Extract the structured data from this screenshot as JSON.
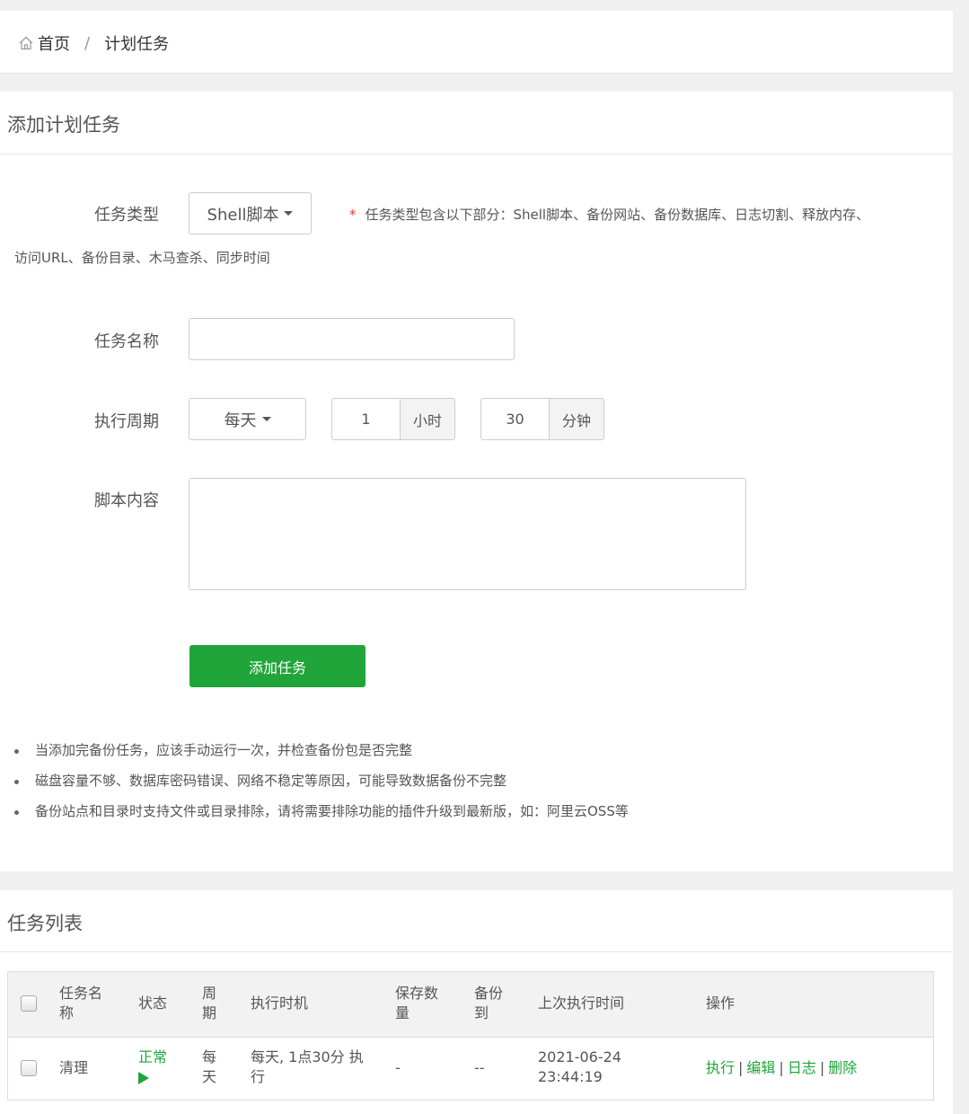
{
  "breadcrumb": {
    "home": "首页",
    "separator": "/",
    "current": "计划任务"
  },
  "form": {
    "title": "添加计划任务",
    "task_type": {
      "label": "任务类型",
      "value": "Shell脚本",
      "hint_star": "*",
      "hint_line1": "任务类型包含以下部分：Shell脚本、备份网站、备份数据库、日志切割、释放内存、",
      "hint_line2": "访问URL、备份目录、木马查杀、同步时间"
    },
    "task_name": {
      "label": "任务名称",
      "value": ""
    },
    "period": {
      "label": "执行周期",
      "value": "每天",
      "hour": "1",
      "hour_unit": "小时",
      "minute": "30",
      "minute_unit": "分钟"
    },
    "script": {
      "label": "脚本内容",
      "value": ""
    },
    "submit_label": "添加任务",
    "tips": [
      "当添加完备份任务，应该手动运行一次，并检查备份包是否完整",
      "磁盘容量不够、数据库密码错误、网络不稳定等原因，可能导致数据备份不完整",
      "备份站点和目录时支持文件或目录排除，请将需要排除功能的插件升级到最新版，如：阿里云OSS等"
    ]
  },
  "list": {
    "title": "任务列表",
    "columns": {
      "name": [
        "任务名",
        "称"
      ],
      "status": "状态",
      "period": [
        "周",
        "期"
      ],
      "timing": "执行时机",
      "keep": [
        "保存数",
        "量"
      ],
      "backup_to": [
        "备份",
        "到"
      ],
      "last_run": "上次执行时间",
      "ops": "操作"
    },
    "rows": [
      {
        "name": "清理",
        "status": "正常",
        "period": [
          "每",
          "天"
        ],
        "timing": [
          "每天, 1点30分 执",
          "行"
        ],
        "keep": "-",
        "backup_to": "--",
        "last_run": [
          "2021-06-24",
          "23:44:19"
        ],
        "ops": {
          "run": "执行",
          "edit": "编辑",
          "log": "日志",
          "delete": "删除",
          "separator": "|"
        }
      }
    ]
  }
}
